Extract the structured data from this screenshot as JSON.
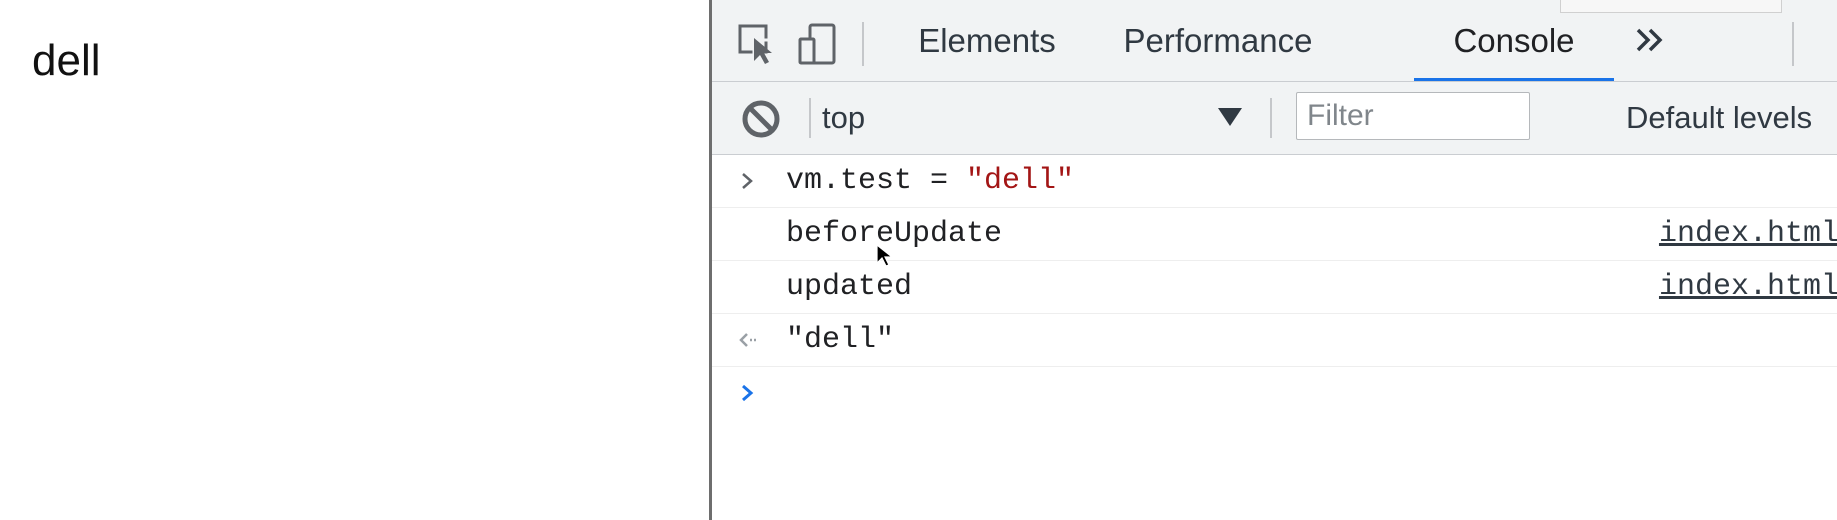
{
  "page": {
    "content_text": "dell"
  },
  "devtools": {
    "tabs": [
      {
        "label": "Elements",
        "active": false
      },
      {
        "label": "Performance",
        "active": false
      },
      {
        "label": "Console",
        "active": true
      }
    ],
    "more_tabs_icon": "double-chevron-right-icon",
    "toolbar": {
      "clear_icon": "clear-console-icon",
      "context": "top",
      "filter_placeholder": "Filter",
      "levels_label": "Default levels"
    },
    "console": {
      "lines": [
        {
          "type": "input",
          "code_prefix": "vm.test = ",
          "code_string": "\"dell\""
        },
        {
          "type": "log",
          "text": "beforeUpdate",
          "source": "index.html"
        },
        {
          "type": "log",
          "text": "updated",
          "source": "index.html"
        },
        {
          "type": "result",
          "value": "\"dell\""
        }
      ]
    }
  },
  "colors": {
    "accent": "#1a73e8",
    "string": "#a31515",
    "toolbar_bg": "#f1f3f4"
  }
}
